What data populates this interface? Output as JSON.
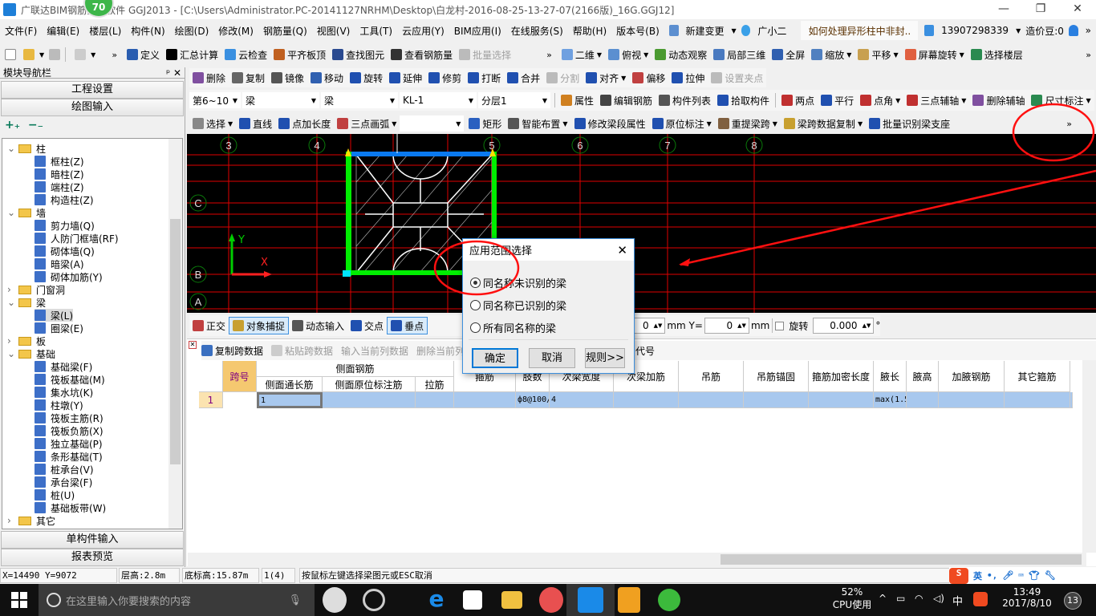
{
  "window": {
    "title": "广联达BIM钢筋算量软件 GGJ2013 - [C:\\Users\\Administrator.PC-20141127NRHM\\Desktop\\白龙村-2016-08-25-13-27-07(2166版)_16G.GGJ12]",
    "badge": "70",
    "minimize": "—",
    "restore": "❐",
    "close": "✕"
  },
  "menu": [
    "文件(F)",
    "编辑(E)",
    "楼层(L)",
    "构件(N)",
    "绘图(D)",
    "修改(M)",
    "钢筋量(Q)",
    "视图(V)",
    "工具(T)",
    "云应用(Y)",
    "BIM应用(I)",
    "在线服务(S)",
    "帮助(H)",
    "版本号(B)"
  ],
  "menu_extra": {
    "new_change": "新建变更",
    "assistant": "广小二",
    "tip": "如何处理异形柱中非封..",
    "account": "13907298339",
    "beans": "造价豆:0",
    "more": "»"
  },
  "toolbar1": {
    "left": [
      {
        "label": "定义",
        "icon": "define-icon",
        "color": "#2a5db0"
      },
      {
        "label": "汇总计算",
        "icon": "sigma-icon",
        "color": "#000"
      },
      {
        "label": "云检查",
        "icon": "cloud-check-icon",
        "color": "#3a8fe0"
      },
      {
        "label": "平齐板顶",
        "icon": "align-slab-icon",
        "color": "#c06020"
      },
      {
        "label": "查找图元",
        "icon": "binoculars-icon",
        "color": "#2a4a90"
      },
      {
        "label": "查看钢筋量",
        "icon": "glasses-icon",
        "color": "#333"
      },
      {
        "label": "批量选择",
        "icon": "batch-select-icon",
        "color": "#bbb",
        "disabled": true
      }
    ],
    "right": [
      {
        "label": "二维",
        "icon": "2d-icon",
        "color": "#6fa0e0",
        "dropdown": true
      },
      {
        "label": "俯视",
        "icon": "top-view-icon",
        "color": "#5b8fd0",
        "dropdown": true
      },
      {
        "label": "动态观察",
        "icon": "orbit-icon",
        "color": "#4a9a30"
      },
      {
        "label": "局部三维",
        "icon": "local-3d-icon",
        "color": "#4a7ac0"
      },
      {
        "label": "全屏",
        "icon": "fullscreen-icon",
        "color": "#3060b0"
      },
      {
        "label": "缩放",
        "icon": "zoom-icon",
        "color": "#5080c0",
        "dropdown": true
      },
      {
        "label": "平移",
        "icon": "pan-icon",
        "color": "#c8a050",
        "dropdown": true
      },
      {
        "label": "屏幕旋转",
        "icon": "rotate-screen-icon",
        "color": "#e06040",
        "dropdown": true
      },
      {
        "label": "选择楼层",
        "icon": "select-floor-icon",
        "color": "#2a8a50"
      }
    ]
  },
  "toolbar2": [
    {
      "label": "删除",
      "icon": "eraser-icon",
      "color": "#8050a0"
    },
    {
      "label": "复制",
      "icon": "copy-icon",
      "color": "#666"
    },
    {
      "label": "镜像",
      "icon": "mirror-icon",
      "color": "#555"
    },
    {
      "label": "移动",
      "icon": "move-icon",
      "color": "#3060b0"
    },
    {
      "label": "旋转",
      "icon": "rotate-icon",
      "color": "#2050b0"
    },
    {
      "label": "延伸",
      "icon": "extend-icon",
      "color": "#2050b0"
    },
    {
      "label": "修剪",
      "icon": "trim-icon",
      "color": "#2050b0"
    },
    {
      "label": "打断",
      "icon": "break-icon",
      "color": "#2050b0"
    },
    {
      "label": "合并",
      "icon": "merge-icon",
      "color": "#2050b0"
    },
    {
      "label": "分割",
      "icon": "split-icon",
      "color": "#bbb",
      "disabled": true
    },
    {
      "label": "对齐",
      "icon": "align-icon",
      "color": "#2050b0",
      "dropdown": true
    },
    {
      "label": "偏移",
      "icon": "offset-icon",
      "color": "#c04040"
    },
    {
      "label": "拉伸",
      "icon": "stretch-icon",
      "color": "#2050b0"
    },
    {
      "label": "设置夹点",
      "icon": "grip-icon",
      "color": "#bbb",
      "disabled": true
    }
  ],
  "toolbar3": {
    "selects": [
      "第6~10",
      "梁",
      "梁",
      "KL-1",
      "分层1"
    ],
    "items": [
      {
        "label": "属性",
        "icon": "properties-icon",
        "color": "#d08020"
      },
      {
        "label": "编辑钢筋",
        "icon": "edit-rebar-icon",
        "color": "#444"
      },
      {
        "label": "构件列表",
        "icon": "component-list-icon",
        "color": "#555"
      },
      {
        "label": "拾取构件",
        "icon": "pick-icon",
        "color": "#2050b0"
      }
    ],
    "aux": [
      {
        "label": "两点",
        "icon": "two-point-icon",
        "color": "#c03030"
      },
      {
        "label": "平行",
        "icon": "parallel-icon",
        "color": "#2050b0"
      },
      {
        "label": "点角",
        "icon": "point-angle-icon",
        "color": "#c03030",
        "dropdown": true
      },
      {
        "label": "三点辅轴",
        "icon": "three-point-axis-icon",
        "color": "#c03030",
        "dropdown": true
      },
      {
        "label": "删除辅轴",
        "icon": "delete-axis-icon",
        "color": "#8050a0"
      },
      {
        "label": "尺寸标注",
        "icon": "dimension-icon",
        "color": "#2a8a50",
        "dropdown": true
      }
    ]
  },
  "toolbar4": {
    "items": [
      {
        "label": "选择",
        "icon": "cursor-icon",
        "color": "#888",
        "dropdown": true
      },
      {
        "label": "直线",
        "icon": "line-icon",
        "color": "#2050b0"
      },
      {
        "label": "点加长度",
        "icon": "point-length-icon",
        "color": "#2050b0"
      },
      {
        "label": "三点画弧",
        "icon": "arc-icon",
        "color": "#c04040",
        "dropdown": true
      }
    ],
    "items2": [
      {
        "label": "矩形",
        "icon": "rectangle-icon",
        "color": "#2a60c0"
      },
      {
        "label": "智能布置",
        "icon": "smart-layout-icon",
        "color": "#555",
        "dropdown": true
      },
      {
        "label": "修改梁段属性",
        "icon": "modify-beam-icon",
        "color": "#2050b0"
      },
      {
        "label": "原位标注",
        "icon": "in-situ-icon",
        "color": "#2050b0",
        "dropdown": true
      },
      {
        "label": "重提梁跨",
        "icon": "re-span-icon",
        "color": "#806040",
        "dropdown": true
      },
      {
        "label": "梁跨数据复制",
        "icon": "span-copy-icon",
        "color": "#c8a030",
        "dropdown": true
      },
      {
        "label": "批量识别梁支座",
        "icon": "batch-support-icon",
        "color": "#2050b0"
      }
    ],
    "more": "»"
  },
  "nav": {
    "title": "模块导航栏",
    "pin": "ᵖ",
    "close": "✕",
    "project_settings": "工程设置",
    "drawing_input": "绘图输入",
    "expand": "+₊",
    "collapse": "−₋",
    "single_input": "单构件输入",
    "report": "报表预览",
    "tree": [
      {
        "label": "柱",
        "type": "folder",
        "open": true
      },
      {
        "label": "框柱(Z)",
        "type": "leaf"
      },
      {
        "label": "暗柱(Z)",
        "type": "leaf"
      },
      {
        "label": "端柱(Z)",
        "type": "leaf"
      },
      {
        "label": "构造柱(Z)",
        "type": "leaf"
      },
      {
        "label": "墙",
        "type": "folder",
        "open": true
      },
      {
        "label": "剪力墙(Q)",
        "type": "leaf"
      },
      {
        "label": "人防门框墙(RF)",
        "type": "leaf"
      },
      {
        "label": "砌体墙(Q)",
        "type": "leaf"
      },
      {
        "label": "暗梁(A)",
        "type": "leaf"
      },
      {
        "label": "砌体加筋(Y)",
        "type": "leaf"
      },
      {
        "label": "门窗洞",
        "type": "folder",
        "open": false
      },
      {
        "label": "梁",
        "type": "folder",
        "open": true
      },
      {
        "label": "梁(L)",
        "type": "leaf",
        "selected": true
      },
      {
        "label": "圈梁(E)",
        "type": "leaf"
      },
      {
        "label": "板",
        "type": "folder",
        "open": false
      },
      {
        "label": "基础",
        "type": "folder",
        "open": true
      },
      {
        "label": "基础梁(F)",
        "type": "leaf"
      },
      {
        "label": "筏板基础(M)",
        "type": "leaf"
      },
      {
        "label": "集水坑(K)",
        "type": "leaf"
      },
      {
        "label": "柱墩(Y)",
        "type": "leaf"
      },
      {
        "label": "筏板主筋(R)",
        "type": "leaf"
      },
      {
        "label": "筏板负筋(X)",
        "type": "leaf"
      },
      {
        "label": "独立基础(P)",
        "type": "leaf"
      },
      {
        "label": "条形基础(T)",
        "type": "leaf"
      },
      {
        "label": "桩承台(V)",
        "type": "leaf"
      },
      {
        "label": "承台梁(F)",
        "type": "leaf"
      },
      {
        "label": "桩(U)",
        "type": "leaf"
      },
      {
        "label": "基础板带(W)",
        "type": "leaf"
      },
      {
        "label": "其它",
        "type": "folder",
        "open": false
      }
    ]
  },
  "canvas": {
    "axes_top": [
      "3",
      "4",
      "5",
      "6",
      "7",
      "8"
    ],
    "axes_left": [
      "C",
      "B",
      "A"
    ],
    "axis_x": "X",
    "axis_y": "Y",
    "colors": {
      "grid": "#ff0000",
      "beam": "#00ff00",
      "selected_beam": "#0080ff",
      "background": "#000000"
    }
  },
  "dialog": {
    "title": "应用范围选择",
    "close": "✕",
    "options": [
      {
        "label": "同名称未识别的梁",
        "checked": true
      },
      {
        "label": "同名称已识别的梁",
        "checked": false
      },
      {
        "label": "所有同名称的梁",
        "checked": false
      }
    ],
    "ok": "确定",
    "cancel": "取消",
    "rules": "规则>>"
  },
  "snapbar": {
    "items": [
      {
        "label": "正交",
        "icon": "ortho-icon",
        "color": "#c04040"
      },
      {
        "label": "对象捕捉",
        "icon": "snap-icon",
        "color": "#c8a030",
        "active": true
      },
      {
        "label": "动态输入",
        "icon": "dynamic-input-icon",
        "color": "#555"
      },
      {
        "label": "交点",
        "icon": "intersection-icon",
        "color": "#2050b0"
      },
      {
        "label": "垂点",
        "icon": "perpendicular-icon",
        "color": "#2050b0",
        "active": true
      }
    ],
    "x_label": "X=",
    "x_value": "0",
    "y_label": "mm Y=",
    "y_value": "0",
    "mm": "mm",
    "rotate_label": "旋转",
    "rotate_value": "0.000",
    "degree": "°"
  },
  "grid_toolbar": {
    "copy": "复制跨数据",
    "paste": "粘贴跨数据",
    "input_col": "输入当前列数据",
    "delete_col": "删除当前列数据",
    "code": "代号"
  },
  "table": {
    "group_side": "侧面钢筋",
    "headers": [
      "跨号",
      "侧面通长筋",
      "侧面原位标注筋",
      "拉筋",
      "箍筋",
      "肢数",
      "次梁宽度",
      "次梁加筋",
      "吊筋",
      "吊筋锚固",
      "箍筋加密长度",
      "腋长",
      "腋高",
      "加腋钢筋",
      "其它箍筋"
    ],
    "rows": [
      {
        "index": "1",
        "cells": [
          "1",
          "",
          "",
          "",
          "ф8@100/20",
          "4",
          "",
          "",
          "",
          "",
          "max(1.5*h,50",
          "",
          "",
          "",
          ""
        ]
      }
    ]
  },
  "status": {
    "coords": "X=14490 Y=9072",
    "floor_height": "层高:2.8m",
    "base_height": "底标高:15.87m",
    "span": "1(4)",
    "hint": "按鼠标左键选择梁图元或ESC取消",
    "ime_lang": "英",
    "ime_punct": "•,"
  },
  "taskbar": {
    "search_placeholder": "在这里输入你要搜索的内容",
    "cpu_percent": "52%",
    "cpu_label": "CPU使用",
    "tray_lang": "中",
    "time": "13:49",
    "date": "2017/8/10",
    "notifications": "13"
  }
}
